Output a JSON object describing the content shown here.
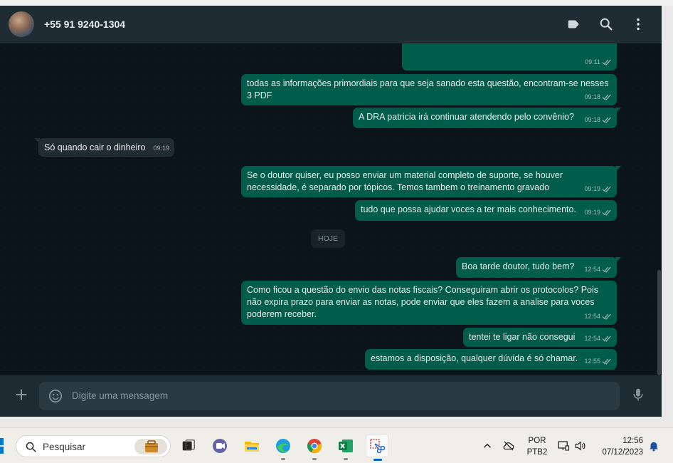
{
  "header": {
    "contact_name": "+55 91 9240-1304"
  },
  "messages": [
    {
      "dir": "out",
      "text": "",
      "time": "09:11"
    },
    {
      "dir": "out",
      "text": "todas as informações primordiais para que seja sanado esta questão, encontram-se nesses 3 PDF",
      "time": "09:18"
    },
    {
      "dir": "out",
      "text": "A DRA patricia irá continuar atendendo pelo convênio?",
      "time": "09:18"
    },
    {
      "dir": "in",
      "text": "Só quando cair o dinheiro",
      "time": "09:19"
    },
    {
      "dir": "out",
      "text": "Se o doutor quiser, eu posso enviar um material completo de suporte, se houver necessidade, é separado por tópicos. Temos tambem o treinamento gravado",
      "time": "09:19"
    },
    {
      "dir": "out",
      "text": "tudo que possa ajudar voces a ter mais conhecimento.",
      "time": "09:19"
    },
    {
      "dir": "out",
      "text": "Boa tarde doutor, tudo bem?",
      "time": "12:54"
    },
    {
      "dir": "out",
      "text": "Como ficou a questão do envio das notas fiscais? Conseguiram abrir os protocolos? Pois não expira prazo para enviar as notas, pode enviar que eles fazem a analise para voces poderem receber.",
      "time": "12:54"
    },
    {
      "dir": "out",
      "text": "tentei te ligar não consegui",
      "time": "12:54"
    },
    {
      "dir": "out",
      "text": "estamos a disposição, qualquer dúvida é só chamar.",
      "time": "12:55"
    }
  ],
  "day_divider": "HOJE",
  "composer": {
    "placeholder": "Digite uma mensagem"
  },
  "taskbar": {
    "search_label": "Pesquisar",
    "language": "POR",
    "keyboard": "PTB2",
    "clock_time": "12:56",
    "clock_date": "07/12/2023"
  },
  "icons": {
    "header": [
      "label-icon",
      "search-icon",
      "more-vertical-icon"
    ],
    "composer": [
      "plus-icon",
      "emoji-icon",
      "mic-icon"
    ],
    "taskbar_apps": [
      "task-view-icon",
      "teams-icon",
      "file-explorer-icon",
      "edge-icon",
      "chrome-icon",
      "excel-icon",
      "snipping-tool-icon"
    ]
  },
  "colors": {
    "outgoing_bubble": "#005c4b",
    "incoming_bubble": "#202c33",
    "chat_background": "#0b141a",
    "header_background": "#202c33"
  }
}
